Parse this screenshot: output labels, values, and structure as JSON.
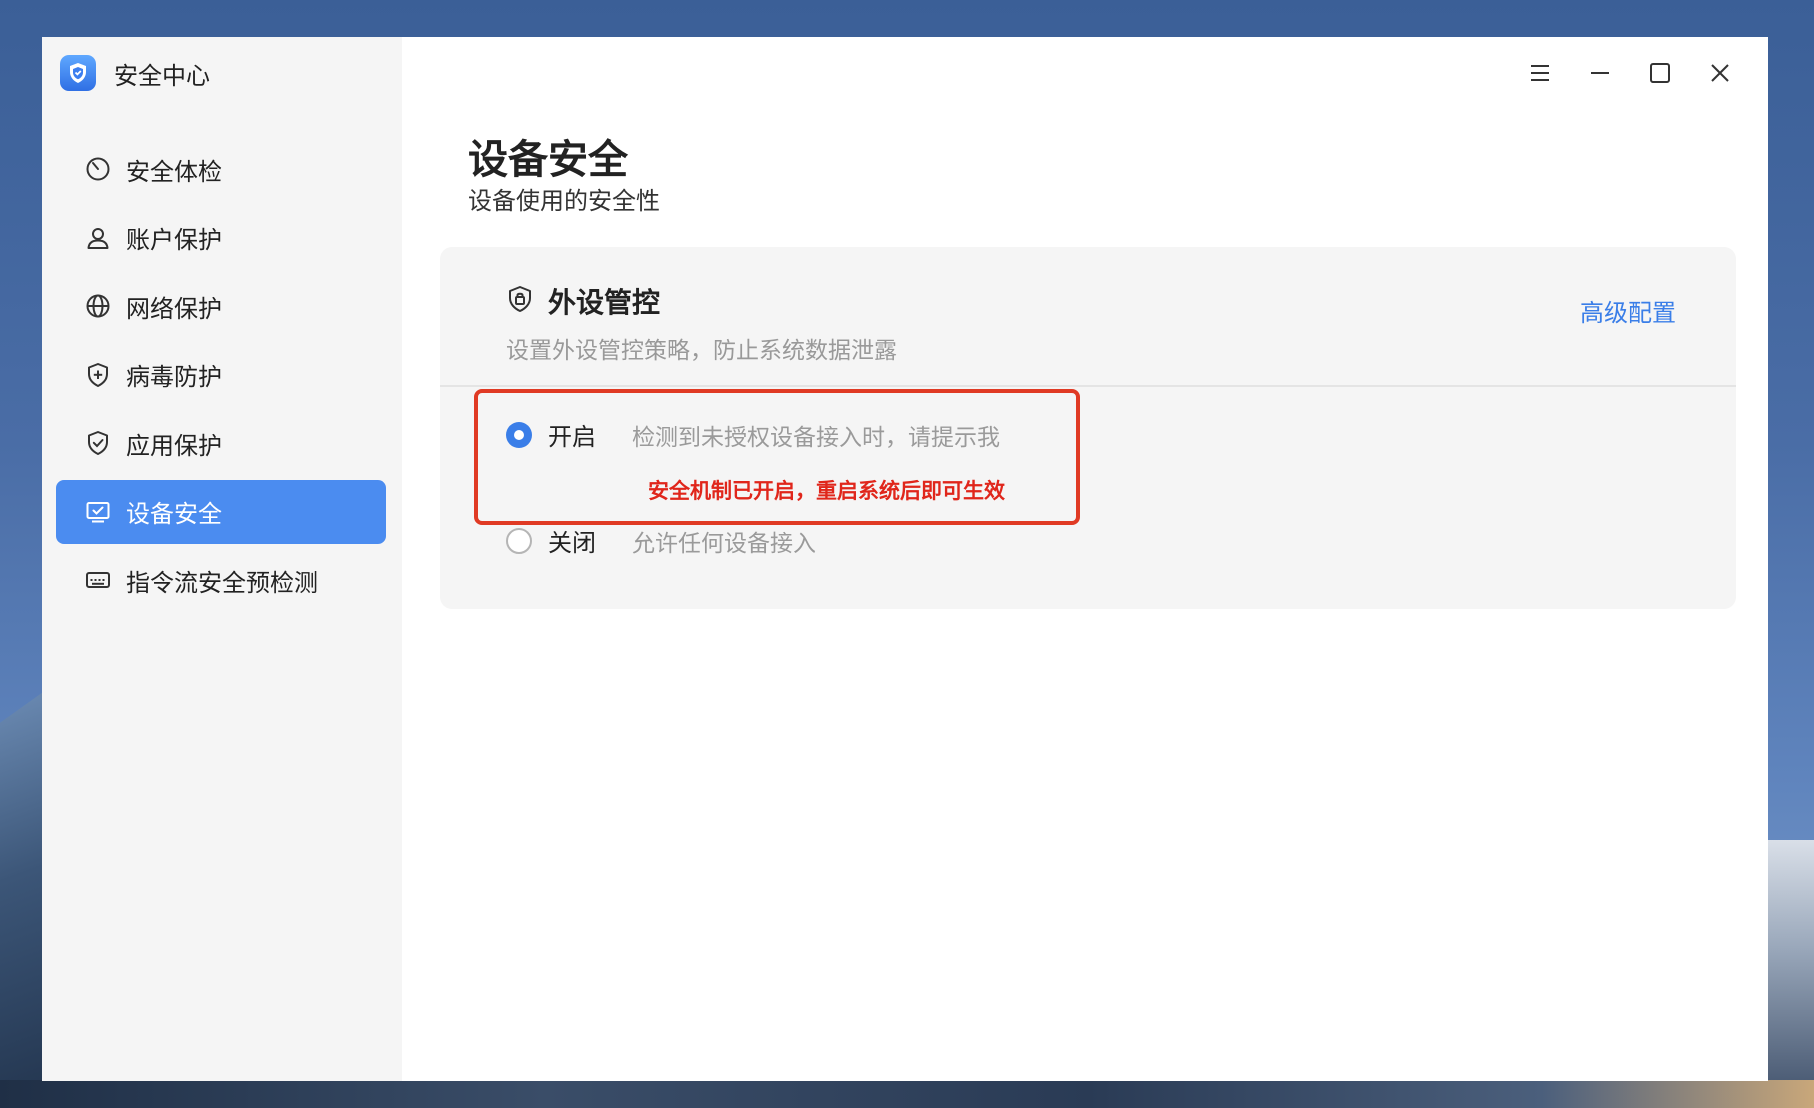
{
  "app": {
    "title": "安全中心"
  },
  "sidebar": {
    "items": [
      {
        "label": "安全体检",
        "icon": "speedometer-icon",
        "active": false
      },
      {
        "label": "账户保护",
        "icon": "user-icon",
        "active": false
      },
      {
        "label": "网络保护",
        "icon": "globe-icon",
        "active": false
      },
      {
        "label": "病毒防护",
        "icon": "shield-plus-icon",
        "active": false
      },
      {
        "label": "应用保护",
        "icon": "shield-check-icon",
        "active": false
      },
      {
        "label": "设备安全",
        "icon": "monitor-check-icon",
        "active": true
      },
      {
        "label": "指令流安全预检测",
        "icon": "keyboard-icon",
        "active": false
      }
    ]
  },
  "main": {
    "title": "设备安全",
    "subtitle": "设备使用的安全性",
    "card": {
      "title": "外设管控",
      "description": "设置外设管控策略，防止系统数据泄露",
      "advanced_link": "高级配置",
      "options": [
        {
          "label": "开启",
          "description": "检测到未授权设备接入时，请提示我",
          "warning": "安全机制已开启，重启系统后即可生效",
          "checked": true
        },
        {
          "label": "关闭",
          "description": "允许任何设备接入",
          "checked": false
        }
      ]
    }
  },
  "colors": {
    "accent": "#4b8cf0",
    "link": "#3a7ee8",
    "warning": "#e0261b",
    "highlight": "#e03a24"
  }
}
